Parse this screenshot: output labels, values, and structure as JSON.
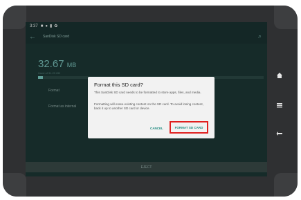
{
  "status_bar": {
    "time": "3:37",
    "icons": [
      "sd-card-icon",
      "settings-dot-icon",
      "notification-icon",
      "sync-icon"
    ]
  },
  "app_bar": {
    "title": "SanDisk SD card",
    "back_icon": "back-arrow-icon",
    "search_icon": "search-icon"
  },
  "storage": {
    "size_value": "32.67",
    "size_unit": "MB",
    "used_caption": "Used of 31.23 GB",
    "used_fraction": 0.02
  },
  "settings_rows": [
    {
      "label": "Format"
    },
    {
      "label": "Format as internal"
    }
  ],
  "eject_label": "EJECT",
  "dialog": {
    "title": "Format this SD card?",
    "body_1": "This SanDisk SD card needs to be formatted to store apps, files, and media.",
    "body_2": "Formatting will erase existing content on the SD card. To avoid losing content, back it up to another SD card or device.",
    "cancel_label": "CANCEL",
    "format_label": "FORMAT SD CARD",
    "highlight_color": "#e0201f"
  },
  "hardware_buttons": [
    "home-icon",
    "menu-icon",
    "back-icon"
  ]
}
